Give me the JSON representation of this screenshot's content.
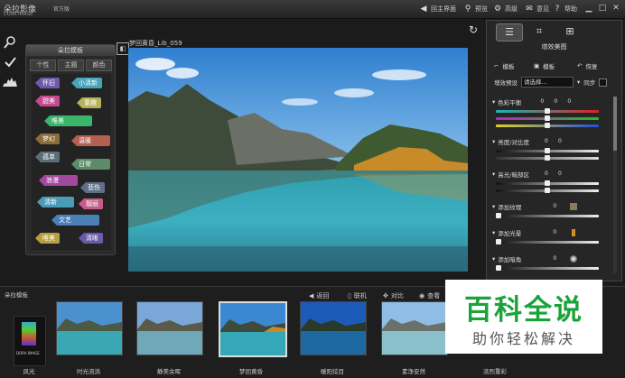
{
  "app": {
    "logo_text": "朵拉影像",
    "logo_sub": "DORA IMAGE",
    "edition": "官方版"
  },
  "titlebar": {
    "home": "回主界面",
    "preview": "预览",
    "advanced": "高级",
    "feedback": "意见",
    "help": "帮助"
  },
  "tag_panel": {
    "title": "朵拉模板",
    "tabs": [
      "个性",
      "主题",
      "颜色"
    ],
    "tags": [
      {
        "label": "怀旧",
        "color": "#6d5aa8"
      },
      {
        "label": "小清新",
        "color": "#4aa3b8"
      },
      {
        "label": "甜美",
        "color": "#c44a8e"
      },
      {
        "label": "童趣",
        "color": "#b7b25a"
      },
      {
        "label": "唯美",
        "color": "#3bb56a"
      },
      {
        "label": "梦幻",
        "color": "#8b6d3a"
      },
      {
        "label": "温暖",
        "color": "#b46050"
      },
      {
        "label": "孤单",
        "color": "#5b6d78"
      },
      {
        "label": "日常",
        "color": "#5c8a6a"
      },
      {
        "label": "浪漫",
        "color": "#a3489e"
      },
      {
        "label": "悲伤",
        "color": "#5f6f8a"
      },
      {
        "label": "清新",
        "color": "#4a9bb8"
      },
      {
        "label": "靓丽",
        "color": "#c95a8a"
      },
      {
        "label": "文艺",
        "color": "#4a7fb8"
      },
      {
        "label": "唯美",
        "color": "#b8a040"
      },
      {
        "label": "清晰",
        "color": "#6a5aa8"
      }
    ]
  },
  "photo": {
    "filename": "梦回黄昏_Lib_059"
  },
  "right_panel": {
    "title": "增效美图",
    "template_btn": "模板",
    "save_template_btn": "模板",
    "restore_btn": "恢复",
    "preset_label": "增效预设",
    "preset_value": "请选择...",
    "sync_label": "同步",
    "sections": [
      {
        "label": "色彩平衡",
        "values": [
          "0",
          "0",
          "0"
        ]
      },
      {
        "label": "亮度/对比度",
        "values": [
          "0",
          "0"
        ]
      },
      {
        "label": "高光/暗部区",
        "values": [
          "0",
          "0"
        ]
      },
      {
        "label": "添加纹理",
        "values": [
          "0"
        ]
      },
      {
        "label": "添加光晕",
        "values": [
          "0"
        ]
      },
      {
        "label": "添加暗角",
        "values": [
          "0"
        ]
      }
    ]
  },
  "bottom": {
    "title": "朵拉模板",
    "actions": {
      "back": "返回",
      "link": "联机",
      "compare": "对比",
      "view": "查看"
    },
    "first_label": "风光",
    "thumbs": [
      "时光流淌",
      "静美余晖",
      "梦回黄昏",
      "暖阳炫目",
      "素净安然",
      "浓烈重彩"
    ]
  },
  "watermark": {
    "main": "百科全说",
    "sub": "助你轻松解决"
  }
}
